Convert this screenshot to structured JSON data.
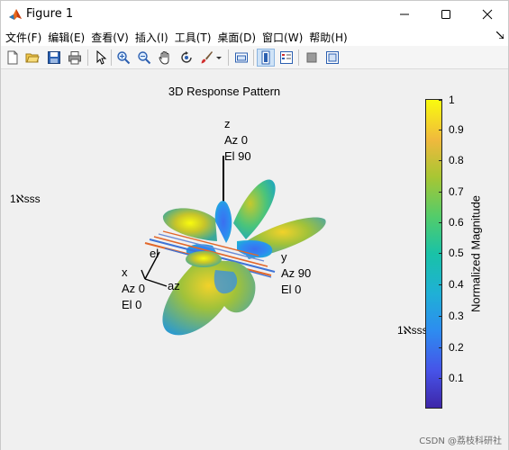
{
  "window": {
    "title": "Figure 1",
    "controls": {
      "minimize": "minimize",
      "maximize": "maximize",
      "close": "close"
    }
  },
  "menubar": {
    "items": [
      "文件(F)",
      "编辑(E)",
      "查看(V)",
      "插入(I)",
      "工具(T)",
      "桌面(D)",
      "窗口(W)",
      "帮助(H)"
    ]
  },
  "toolbar": {
    "icons": [
      "new-figure",
      "open-file",
      "save",
      "print",
      "select-arrow",
      "zoom-in",
      "zoom-out",
      "pan",
      "rotate-3d",
      "data-cursor",
      "brush",
      "link-plot",
      "insert-colorbar",
      "insert-legend",
      "hide-plot-tools",
      "show-plot-tools"
    ]
  },
  "plot": {
    "title": "3D Response Pattern",
    "axis_z": {
      "name": "z",
      "az": "Az 0",
      "el": "El 90"
    },
    "axis_x": {
      "name": "x",
      "az": "Az 0",
      "el": "El 0"
    },
    "axis_y": {
      "name": "y",
      "az": "Az 90",
      "el": "El 0"
    },
    "axis_el": "el",
    "axis_az": "az",
    "stray_text_left": "1ℵsss",
    "stray_text_right": "1ℵsss"
  },
  "colorbar": {
    "label": "Normalized Magnitude",
    "ticks": [
      "1",
      "0.9",
      "0.8",
      "0.7",
      "0.6",
      "0.5",
      "0.4",
      "0.3",
      "0.2",
      "0.1"
    ],
    "colors": {
      "low": "#3e26a8",
      "mid": "#19c2a7",
      "high": "#f9fb0e"
    }
  },
  "watermark": "CSDN @荔枝科研社"
}
